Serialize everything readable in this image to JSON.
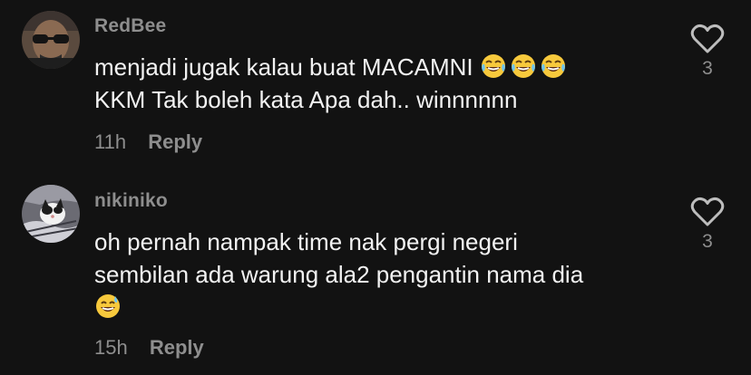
{
  "comments": [
    {
      "username": "RedBee",
      "lines": [
        "menjadi jugak kalau buat MACAMNI",
        "KKM Tak boleh kata Apa dah.. winnnnnn"
      ],
      "emojis_line1": [
        "tears-of-joy-icon",
        "tears-of-joy-icon",
        "tears-of-joy-icon"
      ],
      "time": "11h",
      "reply_label": "Reply",
      "like_count": "3"
    },
    {
      "username": "nikiniko",
      "lines": [
        "oh pernah nampak time nak pergi negeri",
        "sembilan ada warung ala2 pengantin nama dia"
      ],
      "emojis_line3": [
        "grinning-sweat-icon"
      ],
      "time": "15h",
      "reply_label": "Reply",
      "like_count": "3"
    }
  ],
  "colors": {
    "background": "#121212",
    "username": "#8e8e8e",
    "text": "#f2f2f2",
    "meta": "#8e8e8e",
    "heart_outline": "#bdbdbd"
  }
}
